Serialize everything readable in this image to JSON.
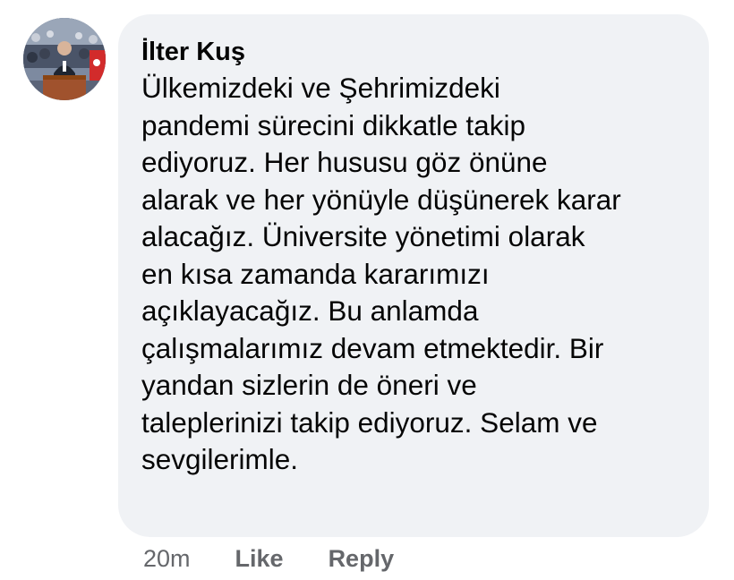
{
  "comment": {
    "author_name": "İlter Kuş",
    "lines": [
      "Ülkemizdeki ve Şehrimizdeki",
      "pandemi sürecini dikkatle takip",
      "ediyoruz. Her hususu göz önüne",
      "alarak ve her yönüyle düşünerek karar",
      "alacağız. Üniversite yönetimi olarak",
      "en kısa zamanda kararımızı",
      "açıklayacağız. Bu anlamda",
      "çalışmalarımız devam etmektedir. Bir",
      "yandan sizlerin de öneri ve",
      "taleplerinizi takip ediyoruz. Selam ve",
      "sevgilerimle."
    ],
    "timestamp": "20m",
    "like_label": "Like",
    "reply_label": "Reply"
  },
  "colors": {
    "bubble_background": "#f0f2f5",
    "text_primary": "#050505",
    "text_secondary": "#65676b"
  }
}
